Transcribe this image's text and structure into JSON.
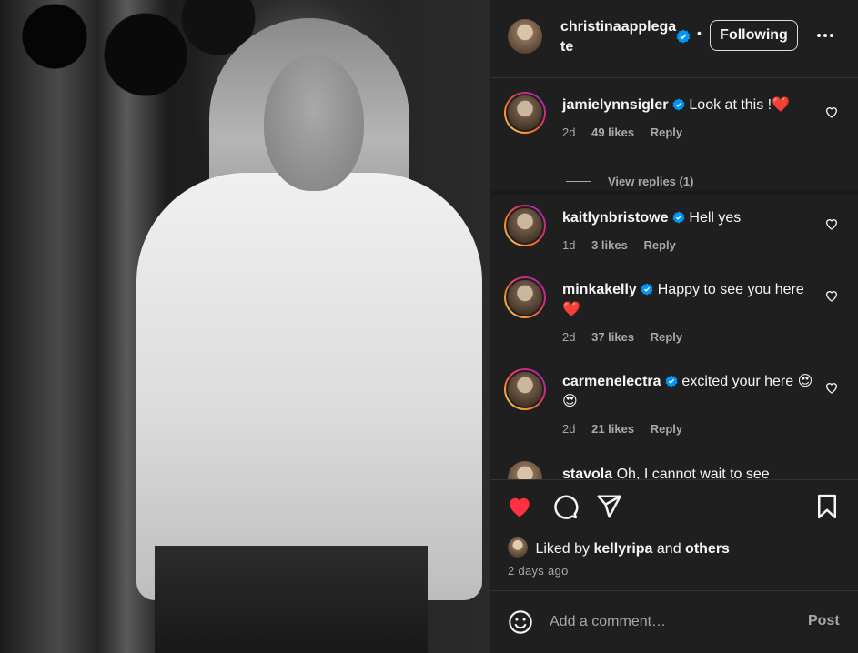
{
  "photo": {
    "alt": ""
  },
  "header": {
    "username": "christinaapplegate",
    "separator": "•",
    "follow_label": "Following",
    "more_icon": "more-horizontal-icon"
  },
  "comments": [
    {
      "username": "jamielynnsigler",
      "text": "Look at this !",
      "emoji": "❤️",
      "age": "2d",
      "likes": "49 likes",
      "reply": "Reply",
      "view_replies": "View replies (1)"
    },
    {
      "username": "kaitlynbristowe",
      "text": "Hell yes",
      "age": "1d",
      "likes": "3 likes",
      "reply": "Reply"
    },
    {
      "username": "minkakelly",
      "text": "Happy to see you here",
      "emoji": "❤️",
      "age": "2d",
      "likes": "37 likes",
      "reply": "Reply"
    },
    {
      "username": "carmenelectra",
      "text": "excited your here",
      "emoji": "😍 😍",
      "age": "2d",
      "likes": "21 likes",
      "reply": "Reply"
    },
    {
      "username": "stavola",
      "text": "Oh, I cannot wait to see"
    }
  ],
  "actions": {
    "liked_prefix": "Liked by",
    "liked_user": "kellyripa",
    "liked_and": "and",
    "liked_others": "others",
    "date": "2 days ago"
  },
  "composer": {
    "placeholder": "Add a comment…",
    "post_label": "Post"
  },
  "colors": {
    "background": "#1f1f1f",
    "verified": "#0095f6",
    "like_red": "#ff3040",
    "muted_text": "#a8a8a8"
  }
}
